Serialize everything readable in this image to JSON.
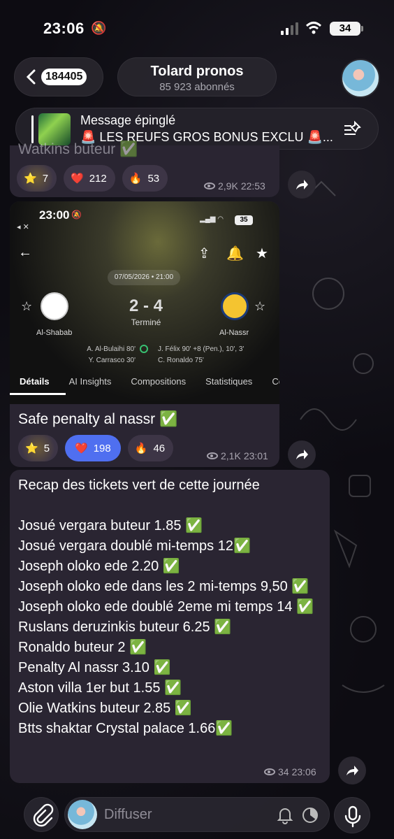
{
  "status_bar": {
    "time": "23:06",
    "battery": "34"
  },
  "header": {
    "back_badge": "184405",
    "channel_name": "Tolard pronos",
    "subscribers": "85 923 abonnés"
  },
  "pinned": {
    "label": "Message épinglé",
    "text": "🚨 LES REUFS GROS BONUS EXCLU 🚨..."
  },
  "messages": [
    {
      "text": "Watkins buteur ✅",
      "reactions": [
        {
          "emoji": "⭐",
          "count": "7"
        },
        {
          "emoji": "❤️",
          "count": "212"
        },
        {
          "emoji": "🔥",
          "count": "53"
        }
      ],
      "views": "2,9K",
      "time": "22:53"
    },
    {
      "text": "Safe penalty al nassr ✅",
      "reactions": [
        {
          "emoji": "⭐",
          "count": "5"
        },
        {
          "emoji": "❤️",
          "count": "198"
        },
        {
          "emoji": "🔥",
          "count": "46"
        }
      ],
      "views": "2,1K",
      "time": "23:01",
      "screenshot": {
        "time": "23:00",
        "battery": "35",
        "date": "07/05/2026 • 21:00",
        "home_team": "Al-Shabab",
        "away_team": "Al-Nassr",
        "score": "2 - 4",
        "status": "Terminé",
        "home_scorers": [
          "A. Al-Bulaihi 80'",
          "Y. Carrasco 30'"
        ],
        "away_scorers": [
          "J. Félix 90' +8 (Pen.), 10', 3'",
          "C. Ronaldo 75'"
        ],
        "tabs": [
          "Détails",
          "AI Insights",
          "Compositions",
          "Statistiques",
          "Co"
        ]
      }
    },
    {
      "title": "Recap des tickets vert de cette journée",
      "lines": [
        "Josué vergara buteur 1.85 ✅",
        "Josué vergara doublé mi-temps 12✅",
        "Joseph oloko ede 2.20 ✅",
        "Joseph oloko ede dans les 2 mi-temps 9,50 ✅",
        "Joseph oloko ede doublé 2eme mi temps 14 ✅",
        "Ruslans deruzinkis buteur 6.25 ✅",
        "Ronaldo buteur 2 ✅",
        "Penalty Al nassr 3.10 ✅",
        "Aston villa 1er but 1.55 ✅",
        "Olie Watkins buteur 2.85 ✅",
        "Btts shaktar Crystal palace 1.66✅"
      ],
      "views": "34",
      "time": "23:06"
    }
  ],
  "composer": {
    "placeholder": "Diffuser"
  }
}
